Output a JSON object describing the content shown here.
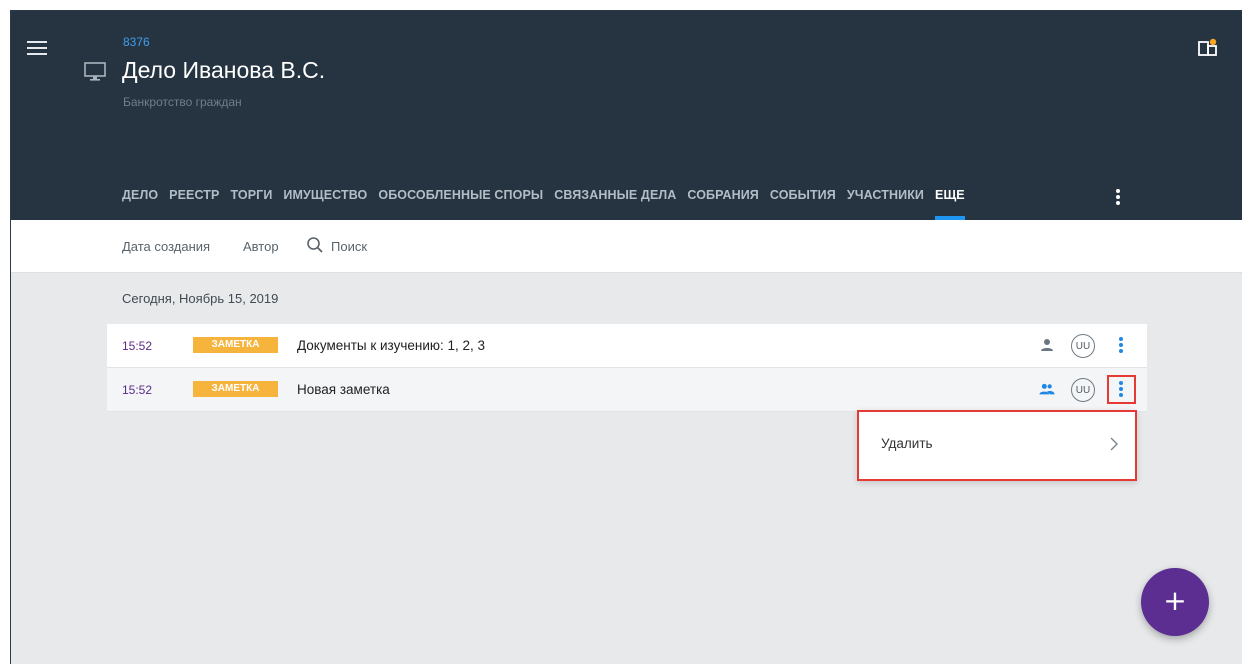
{
  "case": {
    "id": "8376",
    "title": "Дело Иванова В.С.",
    "subtitle": "Банкротство граждан"
  },
  "tabs": [
    {
      "label": "ДЕЛО"
    },
    {
      "label": "РЕЕСТР"
    },
    {
      "label": "ТОРГИ"
    },
    {
      "label": "ИМУЩЕСТВО"
    },
    {
      "label": "ОБОСОБЛЕННЫЕ СПОРЫ"
    },
    {
      "label": "СВЯЗАННЫЕ ДЕЛА"
    },
    {
      "label": "СОБРАНИЯ"
    },
    {
      "label": "СОБЫТИЯ"
    },
    {
      "label": "УЧАСТНИКИ"
    },
    {
      "label": "ЕЩЕ",
      "active": true
    }
  ],
  "toolbar": {
    "date_label": "Дата создания",
    "author_label": "Автор",
    "search_label": "Поиск"
  },
  "list": {
    "date_header": "Сегодня, Ноябрь 15, 2019",
    "rows": [
      {
        "time": "15:52",
        "badge": "ЗАМЕТКА",
        "title": "Документы к изучению: 1, 2, 3",
        "avatar": "UU",
        "icon": "person-icon"
      },
      {
        "time": "15:52",
        "badge": "ЗАМЕТКА",
        "title": "Новая заметка",
        "avatar": "UU",
        "icon": "people-icon"
      }
    ]
  },
  "dropdown": {
    "items": [
      {
        "label": "Удалить"
      }
    ]
  },
  "colors": {
    "header_bg": "#263441",
    "accent_blue": "#1e96f2",
    "badge": "#f6b43c",
    "fab": "#5c2e91",
    "highlight": "#e53935"
  }
}
